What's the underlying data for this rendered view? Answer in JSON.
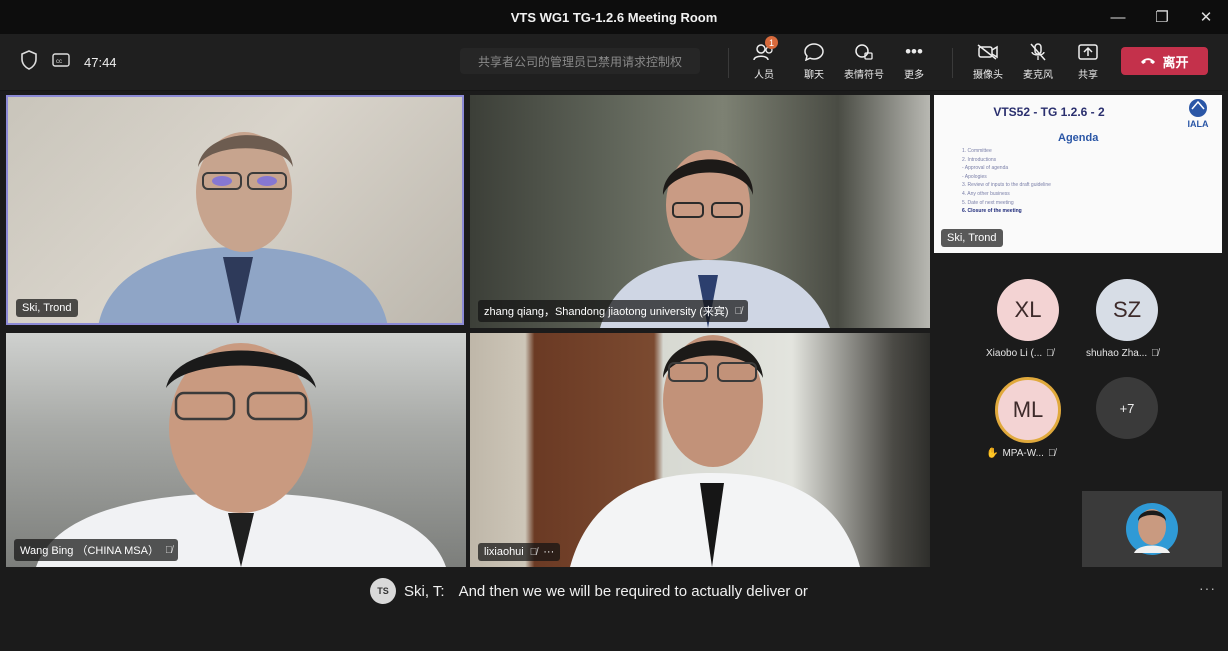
{
  "window": {
    "title": "VTS WG1 TG-1.2.6 Meeting Room",
    "minimize": "—",
    "restore": "❐",
    "close": "✕"
  },
  "toolbar": {
    "timer": "47:44",
    "notice": "共享者公司的管理员已禁用请求控制权",
    "people": {
      "label": "人员",
      "badge": "1"
    },
    "chat": {
      "label": "聊天"
    },
    "reactions": {
      "label": "表情符号"
    },
    "more": {
      "label": "更多"
    },
    "camera": {
      "label": "摄像头"
    },
    "mic": {
      "label": "麦克风"
    },
    "share": {
      "label": "共享"
    },
    "leave": {
      "label": "离开"
    }
  },
  "tiles": [
    {
      "name": "Ski, Trond",
      "active": true
    },
    {
      "name": "zhang qiang，Shandong jiaotong university (来宾)",
      "muted": true
    },
    {
      "name": "Wang Bing （CHINA MSA）",
      "muted": true
    },
    {
      "name": "lixiaohui",
      "muted": true,
      "more": "···"
    }
  ],
  "slide": {
    "title": "VTS52 - TG 1.2.6 - 2",
    "logo_text": "IALA",
    "heading": "Agenda",
    "items": [
      "1.   Committee",
      "2.   Introductions",
      "       - Approval of agenda",
      "       - Apologies",
      "3.   Review of inputs to the draft guideline",
      "4.   Any other business",
      "5.   Date of next meeting",
      "6.   Closure of the meeting"
    ],
    "presenter": "Ski, Trond"
  },
  "participants": [
    {
      "initials": "XL",
      "label": "Xiaobo Li (...",
      "color": "#f3d3d3"
    },
    {
      "initials": "SZ",
      "label": "shuhao Zha...",
      "color": "#d7dde6"
    },
    {
      "initials": "ML",
      "label": "MPA-W...",
      "color": "#f3d3d3",
      "hand": "✋"
    },
    {
      "initials": "+7",
      "color": "#3a3a3a"
    }
  ],
  "caption": {
    "speaker_initials": "TS",
    "speaker": "Ski, T:",
    "text": "And then we we will be required to actually deliver or"
  },
  "colors": {
    "accent": "#8c8ad6",
    "leave": "#c4314b"
  }
}
